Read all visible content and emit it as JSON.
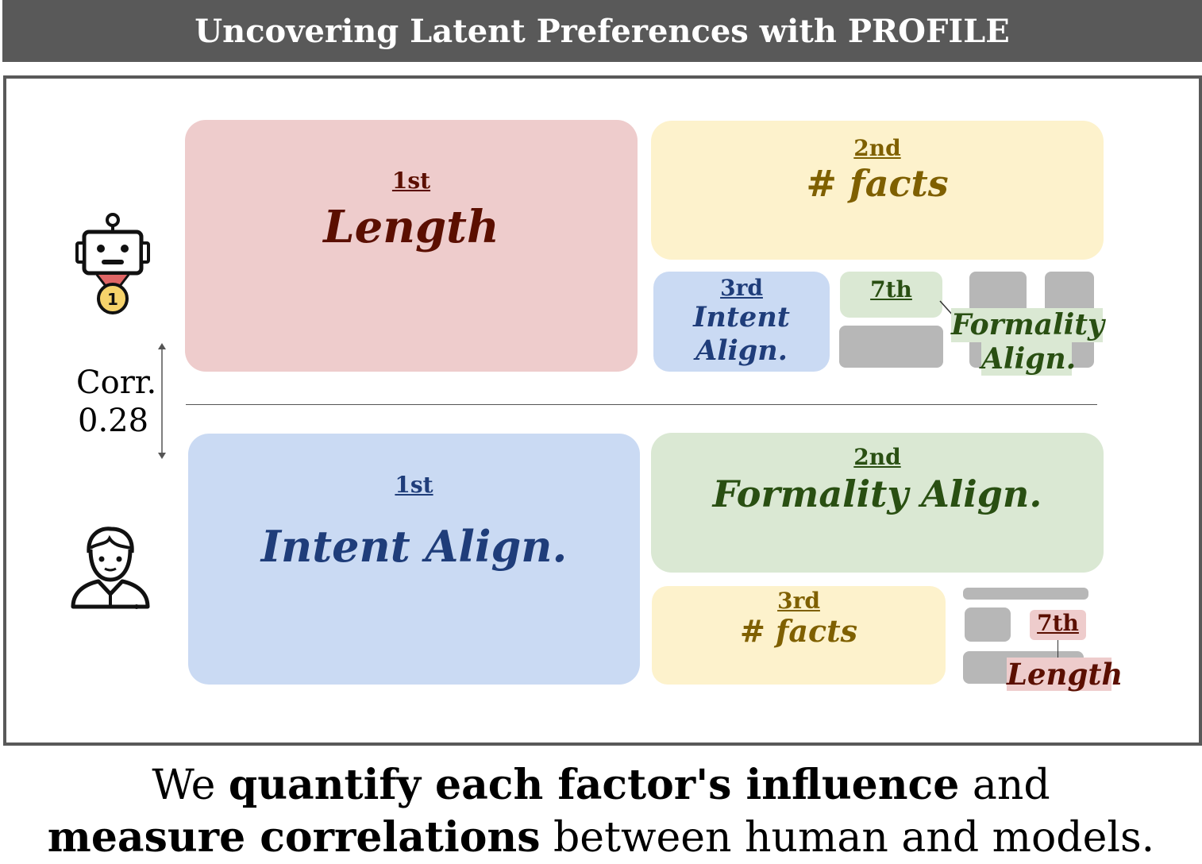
{
  "title": "Uncovering Latent Preferences with PROFILE",
  "model_row": {
    "first": {
      "rank": "1st",
      "name": "Length"
    },
    "second": {
      "rank": "2nd",
      "name": "# facts"
    },
    "third": {
      "rank": "3rd",
      "name_line1": "Intent",
      "name_line2": "Align."
    },
    "seventh": {
      "rank": "7th",
      "name_line1": "Formality",
      "name_line2": "Align."
    }
  },
  "human_row": {
    "first": {
      "rank": "1st",
      "name": "Intent Align."
    },
    "second": {
      "rank": "2nd",
      "name": "Formality Align."
    },
    "third": {
      "rank": "3rd",
      "name": "# facts"
    },
    "seventh": {
      "rank": "7th",
      "name": "Length"
    }
  },
  "correlation": {
    "label": "Corr.",
    "value": "0.28"
  },
  "caption": {
    "l1_a": "We ",
    "l1_b": "quantify each factor's influence",
    "l1_c": " and",
    "l2_a": "measure correlations",
    "l2_b": " between human and models."
  },
  "icons": [
    "robot-icon",
    "medal-icon",
    "person-icon",
    "arrow-icon"
  ],
  "colors": {
    "header_bg": "#595959",
    "pink": "#eecccc",
    "pink_text": "#5b0f00",
    "yellow": "#fdf2cc",
    "yellow_text": "#7f6000",
    "blue": "#cadaf3",
    "blue_text": "#1f3d7a",
    "green": "#dae8d3",
    "green_text": "#294f12",
    "gray": "#b7b7b7"
  }
}
